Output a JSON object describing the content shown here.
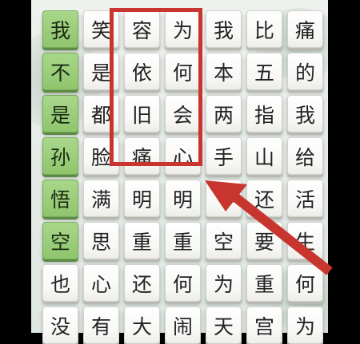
{
  "puzzle": {
    "rows": [
      [
        "我",
        "笑",
        "容",
        "为",
        "我",
        "比",
        "痛"
      ],
      [
        "不",
        "是",
        "依",
        "何",
        "本",
        "五",
        "的"
      ],
      [
        "是",
        "都",
        "旧",
        "会",
        "两",
        "指",
        "我"
      ],
      [
        "孙",
        "脸",
        "痛",
        "心",
        "手",
        "山",
        "给"
      ],
      [
        "悟",
        "满",
        "明",
        "明",
        "",
        "还",
        "活"
      ],
      [
        "空",
        "思",
        "重",
        "重",
        "空",
        "要",
        "生"
      ],
      [
        "也",
        "心",
        "还",
        "何",
        "为",
        "重",
        "何"
      ],
      [
        "没",
        "有",
        "大",
        "闹",
        "天",
        "宫",
        "为"
      ]
    ],
    "found_column_index": 0,
    "found_rows": [
      0,
      1,
      2,
      3,
      4,
      5
    ]
  },
  "colors": {
    "found_tile": "#9ccc7c",
    "highlight": "#c8342e"
  }
}
